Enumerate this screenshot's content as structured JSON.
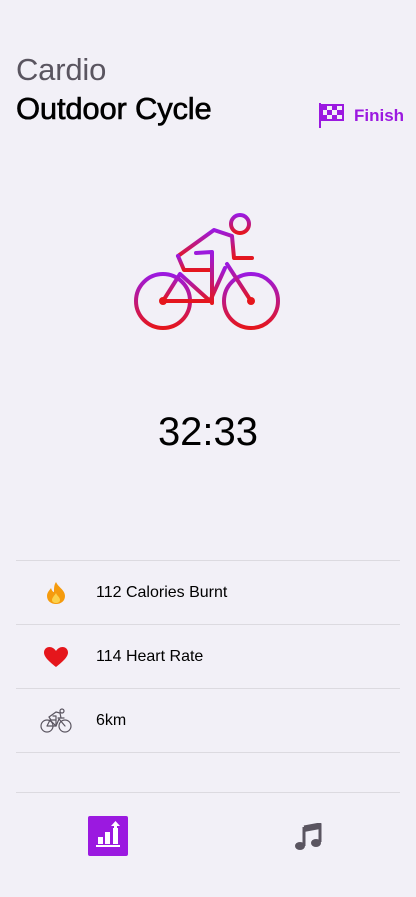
{
  "header": {
    "category": "Cardio",
    "title": "Outdoor Cycle",
    "finish_label": "Finish"
  },
  "workout": {
    "icon": "cycling-icon",
    "timer": "32:33"
  },
  "stats": [
    {
      "icon": "flame-icon",
      "label": "112 Calories Burnt",
      "color": "#f59b0e"
    },
    {
      "icon": "heart-icon",
      "label": "114 Heart Rate",
      "color": "#e5161c"
    },
    {
      "icon": "bicycle-icon",
      "label": "6km",
      "color": "#5a5560"
    }
  ],
  "tabbar": {
    "tabs": [
      {
        "icon": "stats-chart-icon",
        "selected": true
      },
      {
        "icon": "music-note-icon",
        "selected": false
      }
    ]
  },
  "colors": {
    "accent": "#9b19e0",
    "gradient_start": "#9b19e0",
    "gradient_end": "#e5161c",
    "background": "#f2f0f7"
  }
}
